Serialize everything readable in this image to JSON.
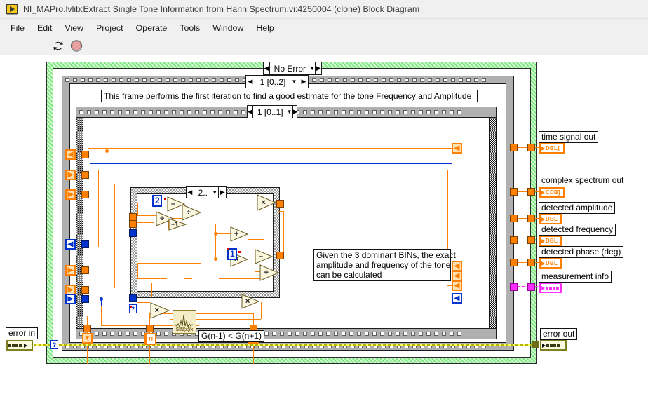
{
  "window": {
    "title": "NI_MAPro.lvlib:Extract Single Tone Information from Hann Spectrum.vi:4250004 (clone) Block Diagram",
    "icon": "labview-vi-icon"
  },
  "menu": {
    "items": [
      {
        "label": "File"
      },
      {
        "label": "Edit"
      },
      {
        "label": "View"
      },
      {
        "label": "Project"
      },
      {
        "label": "Operate"
      },
      {
        "label": "Tools"
      },
      {
        "label": "Window"
      },
      {
        "label": "Help"
      }
    ]
  },
  "toolbar": {
    "buttons": [
      {
        "name": "run-continuously-button",
        "icon": "run-continuously-icon"
      },
      {
        "name": "abort-execution-button",
        "icon": "abort-stop-icon"
      }
    ]
  },
  "diagram": {
    "case_structures": [
      {
        "name": "error-case-selector",
        "label": "No Error"
      },
      {
        "name": "outer-case-selector",
        "label": "1 [0..2]"
      },
      {
        "name": "middle-case-selector",
        "label": "1 [0..1]"
      },
      {
        "name": "inner-case-selector",
        "label": "2.."
      }
    ],
    "comments": [
      {
        "name": "first-iteration-comment",
        "text": "This frame performs the first iteration to find a good estimate for the tone Frequency and Amplitude"
      },
      {
        "name": "dominant-bins-comment",
        "text": "Given the 3 dominant BINs, the exact\namplitude and frequency of the tone\ncan be calculated"
      },
      {
        "name": "comparison-label",
        "text": "G(n-1) < G(n+1)"
      }
    ],
    "controls": [
      {
        "name": "error-in-terminal",
        "label": "error in",
        "type": "error-cluster"
      }
    ],
    "indicators": [
      {
        "name": "time-signal-out-terminal",
        "label": "time signal out",
        "type": "DBL]"
      },
      {
        "name": "complex-spectrum-out-terminal",
        "label": "complex spectrum out",
        "type": "CDB]"
      },
      {
        "name": "detected-amplitude-terminal",
        "label": "detected amplitude",
        "type": "DBL"
      },
      {
        "name": "detected-frequency-terminal",
        "label": "detected frequency",
        "type": "DBL"
      },
      {
        "name": "detected-phase-terminal",
        "label": "detected phase (deg)",
        "type": "DBL"
      },
      {
        "name": "measurement-info-terminal",
        "label": "measurement info",
        "type": "cluster"
      },
      {
        "name": "error-out-terminal",
        "label": "error out",
        "type": "error-cluster"
      }
    ],
    "constants": [
      {
        "name": "numeric-constant-2",
        "value": "2"
      },
      {
        "name": "numeric-constant-1",
        "value": "1"
      },
      {
        "name": "pi-constant",
        "value": "π"
      }
    ],
    "functions": [
      {
        "name": "divide-1",
        "glyph": "÷"
      },
      {
        "name": "subtract-1",
        "glyph": "–"
      },
      {
        "name": "increment-1",
        "glyph": "+1"
      },
      {
        "name": "divide-2",
        "glyph": "÷"
      },
      {
        "name": "add-1",
        "glyph": "+"
      },
      {
        "name": "multiply-1",
        "glyph": "×"
      },
      {
        "name": "multiply-2",
        "glyph": "×"
      },
      {
        "name": "subtract-2",
        "glyph": "–"
      },
      {
        "name": "divide-3",
        "glyph": "÷"
      },
      {
        "name": "multiply-3",
        "glyph": "×"
      }
    ],
    "subvis": [
      {
        "name": "sinc-subvi",
        "caption": "SIN(x)/x"
      }
    ]
  },
  "colors": {
    "wire_double": "#ff8000",
    "wire_integer": "#0033cc",
    "wire_error": "#b3b300",
    "wire_cluster": "#ff2fff",
    "case_border_green": "#7de87d",
    "chrome": "#f0f0f0"
  }
}
